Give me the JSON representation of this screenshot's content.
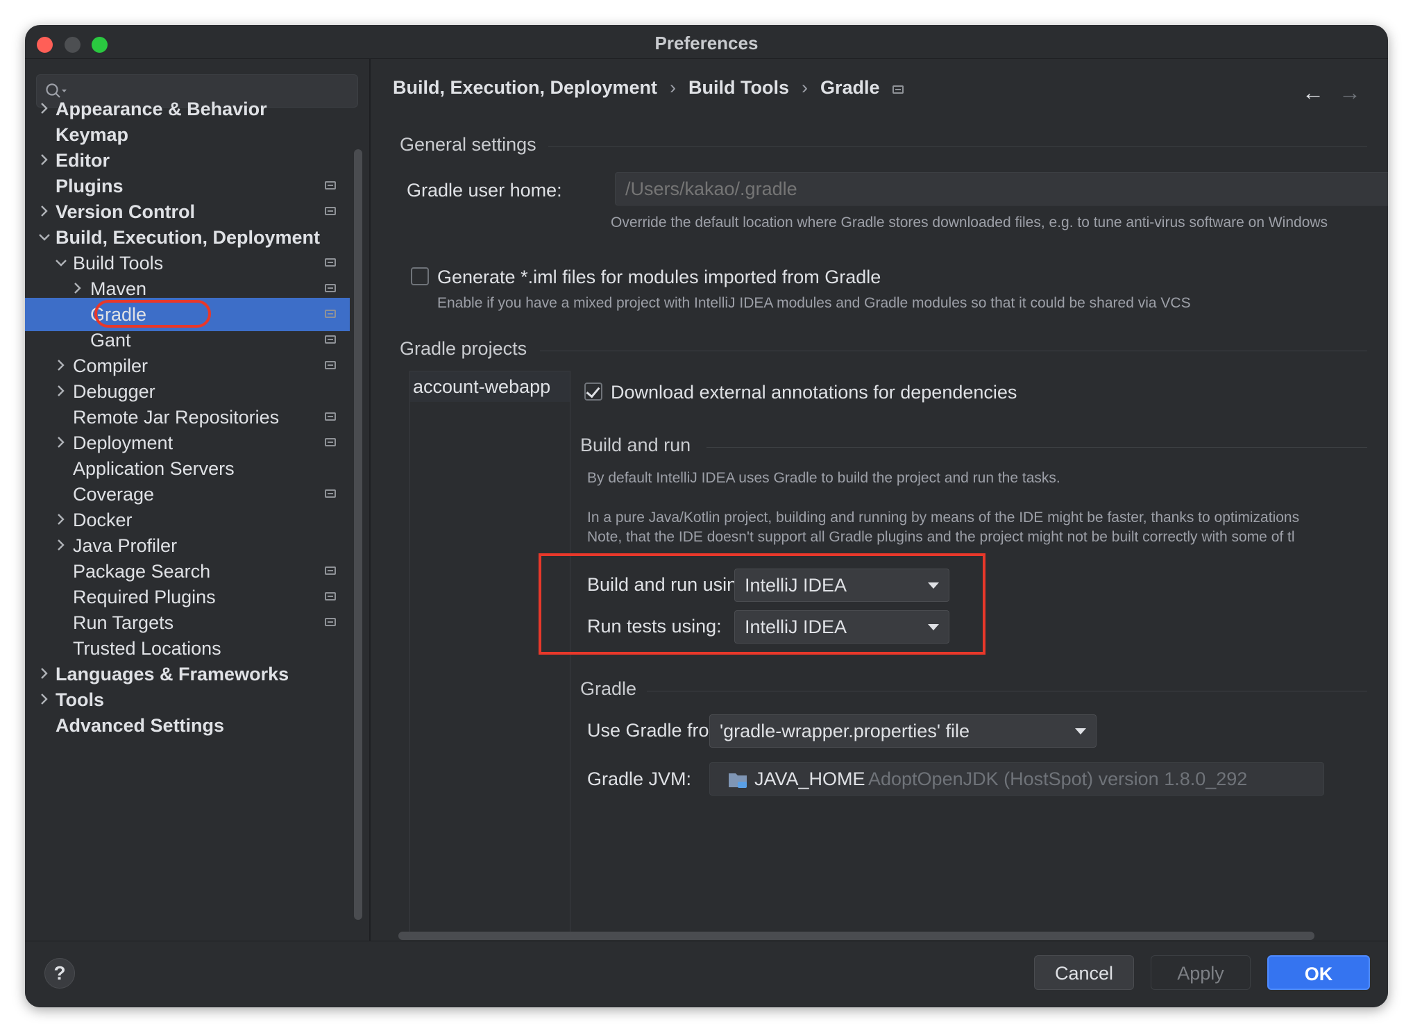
{
  "window": {
    "title": "Preferences"
  },
  "sidebar": {
    "search": {
      "placeholder": ""
    },
    "items": [
      {
        "label": "Appearance & Behavior",
        "chevron": "right",
        "bold": true,
        "page_icon": false
      },
      {
        "label": "Keymap",
        "chevron": "",
        "bold": true,
        "page_icon": false
      },
      {
        "label": "Editor",
        "chevron": "right",
        "bold": true,
        "page_icon": false
      },
      {
        "label": "Plugins",
        "chevron": "",
        "bold": true,
        "page_icon": true
      },
      {
        "label": "Version Control",
        "chevron": "right",
        "bold": true,
        "page_icon": true
      },
      {
        "label": "Build, Execution, Deployment",
        "chevron": "down",
        "bold": true,
        "page_icon": false
      },
      {
        "label": "Build Tools",
        "chevron": "down",
        "bold": false,
        "page_icon": true
      },
      {
        "label": "Maven",
        "chevron": "right",
        "bold": false,
        "page_icon": true
      },
      {
        "label": "Gradle",
        "chevron": "",
        "bold": false,
        "page_icon": true,
        "selected": true
      },
      {
        "label": "Gant",
        "chevron": "",
        "bold": false,
        "page_icon": true
      },
      {
        "label": "Compiler",
        "chevron": "right",
        "bold": false,
        "page_icon": true
      },
      {
        "label": "Debugger",
        "chevron": "right",
        "bold": false,
        "page_icon": false
      },
      {
        "label": "Remote Jar Repositories",
        "chevron": "",
        "bold": false,
        "page_icon": true
      },
      {
        "label": "Deployment",
        "chevron": "right",
        "bold": false,
        "page_icon": true
      },
      {
        "label": "Application Servers",
        "chevron": "",
        "bold": false,
        "page_icon": false
      },
      {
        "label": "Coverage",
        "chevron": "",
        "bold": false,
        "page_icon": true
      },
      {
        "label": "Docker",
        "chevron": "right",
        "bold": false,
        "page_icon": false
      },
      {
        "label": "Java Profiler",
        "chevron": "right",
        "bold": false,
        "page_icon": false
      },
      {
        "label": "Package Search",
        "chevron": "",
        "bold": false,
        "page_icon": true
      },
      {
        "label": "Required Plugins",
        "chevron": "",
        "bold": false,
        "page_icon": true
      },
      {
        "label": "Run Targets",
        "chevron": "",
        "bold": false,
        "page_icon": true
      },
      {
        "label": "Trusted Locations",
        "chevron": "",
        "bold": false,
        "page_icon": false
      },
      {
        "label": "Languages & Frameworks",
        "chevron": "right",
        "bold": true,
        "page_icon": false
      },
      {
        "label": "Tools",
        "chevron": "right",
        "bold": true,
        "page_icon": false
      },
      {
        "label": "Advanced Settings",
        "chevron": "",
        "bold": true,
        "page_icon": false
      }
    ]
  },
  "breadcrumb": {
    "part1": "Build, Execution, Deployment",
    "sep": "›",
    "part2": "Build Tools",
    "part3": "Gradle",
    "back": "←",
    "forward": "→"
  },
  "general": {
    "header": "General settings",
    "user_home_label": "Gradle user home:",
    "user_home_placeholder": "/Users/kakao/.gradle",
    "user_home_hint": "Override the default location where Gradle stores downloaded files, e.g. to tune anti-virus software on Windows",
    "iml_label": "Generate *.iml files for modules imported from Gradle",
    "iml_hint": "Enable if you have a mixed project with IntelliJ IDEA modules and Gradle modules so that it could be shared via VCS"
  },
  "projects": {
    "header": "Gradle projects",
    "items": [
      "account-webapp"
    ],
    "download_label": "Download external annotations for dependencies"
  },
  "build_run": {
    "header": "Build and run",
    "desc1": "By default IntelliJ IDEA uses Gradle to build the project and run the tasks.",
    "desc2": "In a pure Java/Kotlin project, building and running by means of the IDE might be faster, thanks to optimizations",
    "desc3": "Note, that the IDE doesn't support all Gradle plugins and the project might not be built correctly with some of tl",
    "build_label": "Build and run using:",
    "build_value": "IntelliJ IDEA",
    "tests_label": "Run tests using:",
    "tests_value": "IntelliJ IDEA"
  },
  "gradle": {
    "header": "Gradle",
    "use_from_label": "Use Gradle from:",
    "use_from_value": "'gradle-wrapper.properties' file",
    "jvm_label": "Gradle JVM:",
    "jvm_name": "JAVA_HOME",
    "jvm_detail": "AdoptOpenJDK (HostSpot) version 1.8.0_292"
  },
  "buttons": {
    "help": "?",
    "cancel": "Cancel",
    "apply": "Apply",
    "ok": "OK"
  },
  "colors": {
    "accent": "#3574f0",
    "selection": "#3d6ec8",
    "highlight": "#e8382a",
    "background": "#2b2d30"
  }
}
